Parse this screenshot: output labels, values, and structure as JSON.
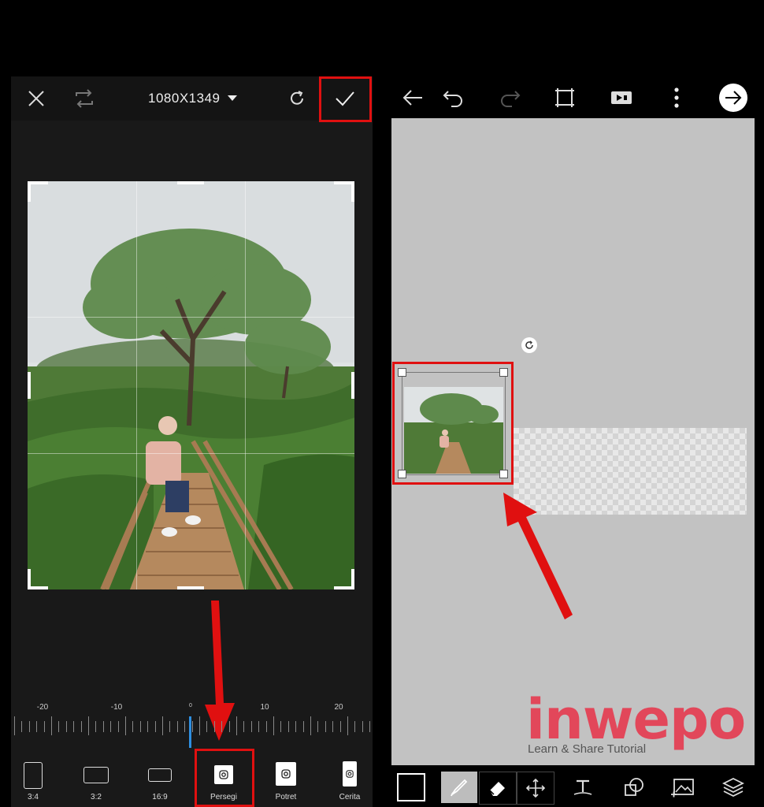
{
  "left": {
    "toolbar": {
      "size_label": "1080X1349"
    },
    "ruler": {
      "labels": [
        "-20",
        "-10",
        "0",
        "10",
        "20"
      ]
    },
    "ratios": [
      {
        "label": "3:4"
      },
      {
        "label": "3:2"
      },
      {
        "label": "16:9"
      },
      {
        "label": "Persegi"
      },
      {
        "label": "Potret"
      },
      {
        "label": "Cerita"
      }
    ]
  },
  "right": {
    "toolbar_icons": [
      "back-arrow-icon",
      "undo-icon",
      "redo-icon",
      "crop-frame-icon",
      "video-camera-icon",
      "more-vertical-icon",
      "next-arrow-icon"
    ],
    "tools": [
      "color-swatch",
      "brush-icon",
      "eraser-icon",
      "move-icon",
      "text-icon",
      "shape-icon",
      "add-photo-icon",
      "layers-icon"
    ]
  },
  "watermark": {
    "word": "inwepo",
    "tagline": "Learn & Share Tutorial"
  },
  "colors": {
    "highlight": "#e01010",
    "accent_blue": "#2f8fe0",
    "brand": "#e2475a"
  }
}
